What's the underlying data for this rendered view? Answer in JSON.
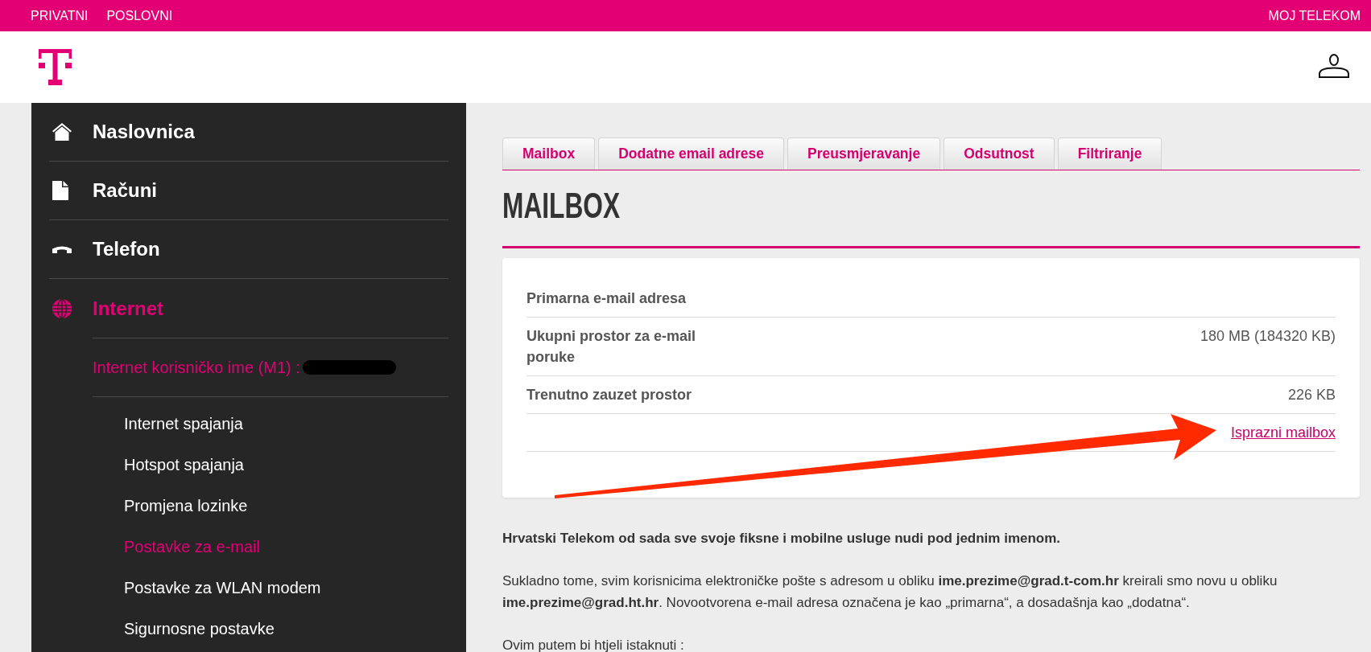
{
  "top_bar": {
    "left_links": [
      "PRIVATNI",
      "POSLOVNI"
    ],
    "right_link": "MOJ TELEKOM"
  },
  "sidebar": {
    "items": [
      {
        "label": "Naslovnica",
        "selected": false
      },
      {
        "label": "Računi",
        "selected": false
      },
      {
        "label": "Telefon",
        "selected": false
      },
      {
        "label": "Internet",
        "selected": true,
        "account_label": "Internet korisničko ime (M1) :",
        "children": [
          {
            "label": "Internet spajanja",
            "selected": false
          },
          {
            "label": "Hotspot spajanja",
            "selected": false
          },
          {
            "label": "Promjena lozinke",
            "selected": false
          },
          {
            "label": "Postavke za e-mail",
            "selected": true
          },
          {
            "label": "Postavke za WLAN modem",
            "selected": false
          },
          {
            "label": "Sigurnosne postavke",
            "selected": false
          }
        ]
      }
    ]
  },
  "tabs": [
    {
      "label": "Mailbox"
    },
    {
      "label": "Dodatne email adrese"
    },
    {
      "label": "Preusmjeravanje"
    },
    {
      "label": "Odsutnost"
    },
    {
      "label": "Filtriranje"
    }
  ],
  "page_title": "MAILBOX",
  "mailbox_card": {
    "rows": [
      {
        "kind": "field",
        "label": "Primarna e-mail adresa"
      },
      {
        "kind": "field",
        "label": "Ukupni prostor za e-mail poruke",
        "value": "180 MB (184320 KB)"
      },
      {
        "kind": "field",
        "label": "Trenutno zauzet prostor",
        "value": "226 KB"
      },
      {
        "kind": "action",
        "link": "Isprazni mailbox"
      }
    ]
  },
  "notice": {
    "headline": "Hrvatski Telekom od sada sve svoje fiksne i mobilne usluge nudi pod jednim imenom.",
    "paragraphs": [
      "Sukladno tome, svim korisnicima elektroničke pošte s adresom u obliku **ime.prezime@grad.t-com.hr** kreirali smo novu u obliku **ime.prezime@grad.ht.hr**. Novootvorena e-mail adresa označena je kao „primarna“, a dosadašnja kao „dodatna“.",
      "Ovim putem bi htjeli istaknuti :"
    ]
  }
}
